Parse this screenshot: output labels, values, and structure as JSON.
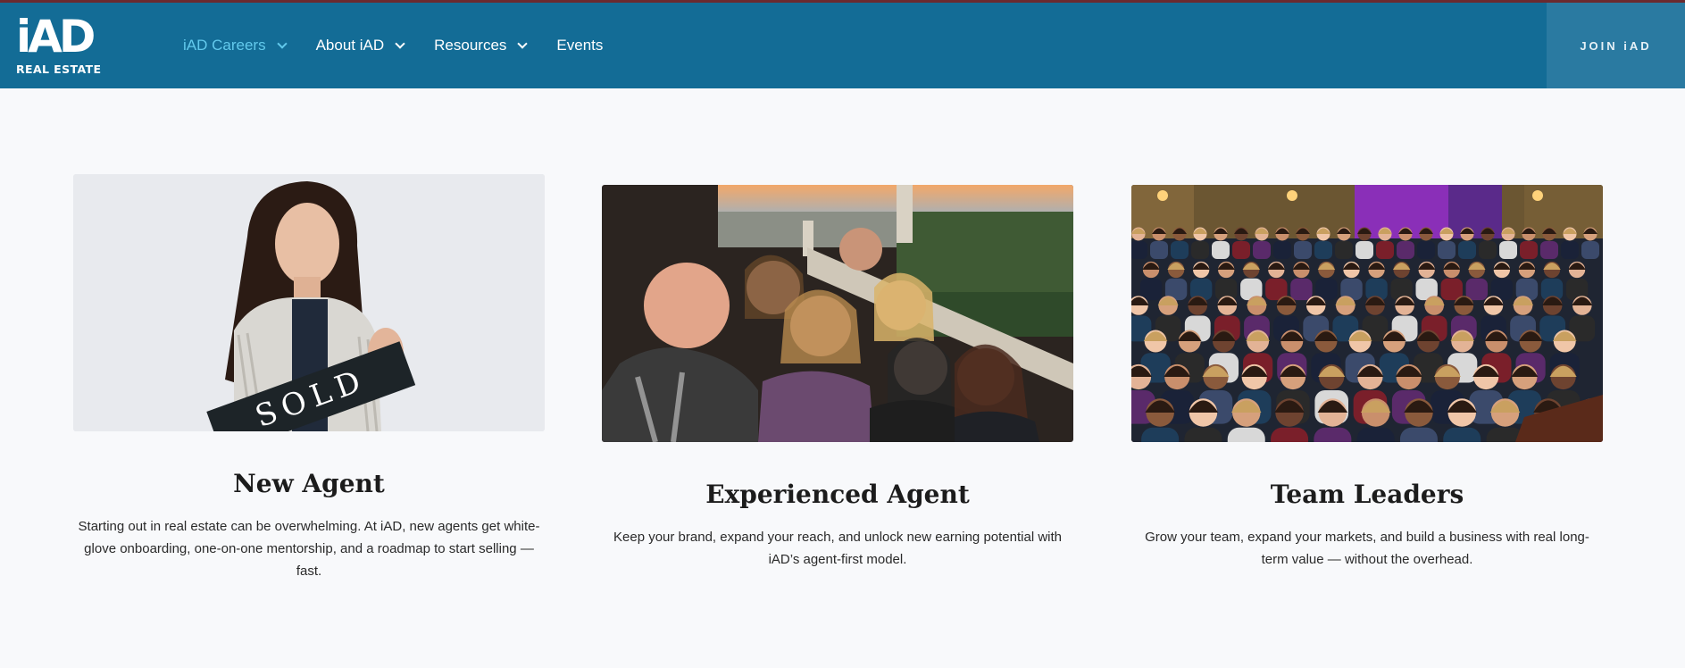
{
  "header": {
    "logo": {
      "mark": "iAD",
      "subtitle": "REAL ESTATE"
    },
    "nav": [
      {
        "label": "iAD Careers",
        "has_dropdown": true,
        "active": true
      },
      {
        "label": "About iAD",
        "has_dropdown": true,
        "active": false
      },
      {
        "label": "Resources",
        "has_dropdown": true,
        "active": false
      },
      {
        "label": "Events",
        "has_dropdown": false,
        "active": false
      }
    ],
    "cta_label": "JOIN iAD"
  },
  "cards": [
    {
      "title": "New Agent",
      "description": "Starting out in real estate can be overwhelming. At iAD, new agents get white-glove onboarding, one-on-one mentorship, and a roadmap to start selling — fast.",
      "image_sign_text": "SOLD"
    },
    {
      "title": "Experienced Agent",
      "description": "Keep your brand, expand your reach, and unlock new earning potential with iAD’s agent-first model."
    },
    {
      "title": "Team Leaders",
      "description": "Grow your team, expand your markets, and build a business with real long-term value — without the overhead."
    }
  ],
  "colors": {
    "nav_bg": "#136c96",
    "nav_active": "#62c9ec",
    "cta_bg": "#2a7aa1",
    "page_bg": "#f8f9fb",
    "top_line": "#6b2a2f"
  }
}
